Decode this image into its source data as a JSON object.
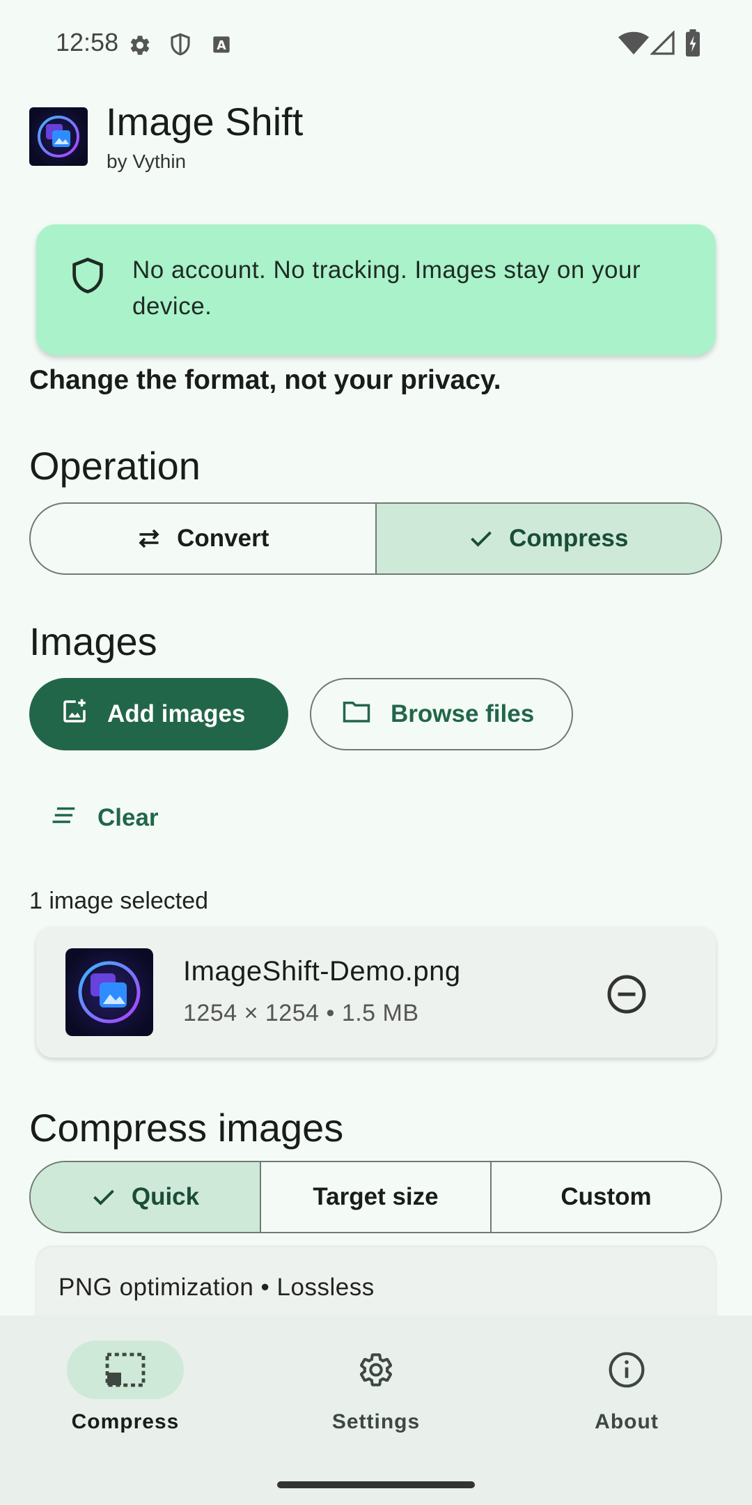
{
  "status_bar": {
    "time": "12:58",
    "left_icons": [
      "gear-icon",
      "shield-icon",
      "keyboard-icon"
    ],
    "right_icons": [
      "wifi-icon",
      "signal-icon",
      "battery-charging-icon"
    ]
  },
  "header": {
    "title": "Image Shift",
    "subtitle": "by Vythin"
  },
  "privacy_banner": {
    "text": "No account. No tracking. Images stay on your device.",
    "icon": "shield-icon",
    "color": "#aaf2ca"
  },
  "tagline": "Change the format, not your privacy.",
  "operation": {
    "heading": "Operation",
    "options": [
      {
        "label": "Convert",
        "icon": "swap-icon",
        "selected": false
      },
      {
        "label": "Compress",
        "icon": "check-icon",
        "selected": true
      }
    ]
  },
  "images": {
    "heading": "Images",
    "add_label": "Add images",
    "browse_label": "Browse files",
    "clear_label": "Clear",
    "selected_count": "1 image selected",
    "files": [
      {
        "name": "ImageShift-Demo.png",
        "meta": "1254 × 1254 • 1.5 MB"
      }
    ]
  },
  "compress": {
    "heading": "Compress images",
    "modes": [
      {
        "label": "Quick",
        "selected": true
      },
      {
        "label": "Target size",
        "selected": false
      },
      {
        "label": "Custom",
        "selected": false
      }
    ],
    "summary": "PNG optimization • Lossless"
  },
  "bottom_nav": {
    "items": [
      {
        "label": "Compress",
        "icon": "compress-icon",
        "active": true
      },
      {
        "label": "Settings",
        "icon": "settings-icon",
        "active": false
      },
      {
        "label": "About",
        "icon": "info-icon",
        "active": false
      }
    ]
  },
  "colors": {
    "accent": "#22664a",
    "selected_segment": "#cfe9d9",
    "background": "#f4fbf6"
  }
}
